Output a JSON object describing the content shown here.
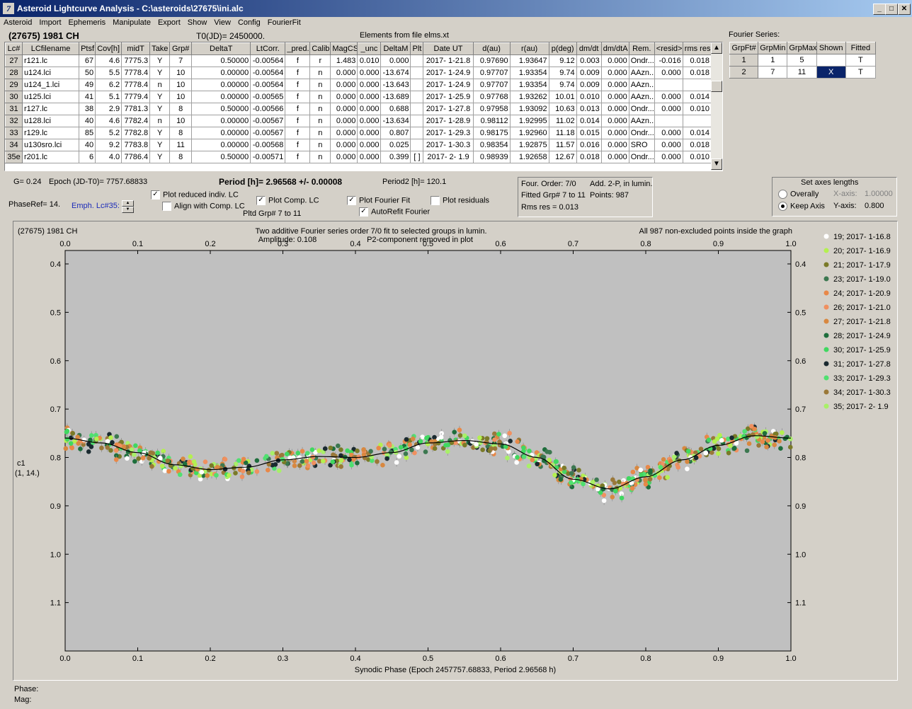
{
  "window": {
    "title": "Asteroid Lightcurve Analysis - C:\\asteroids\\27675\\ini.alc",
    "icon_name": "app-logo-icon"
  },
  "menu": [
    "Asteroid",
    "Import",
    "Ephemeris",
    "Manipulate",
    "Export",
    "Show",
    "View",
    "Config",
    "FourierFit"
  ],
  "header": {
    "asteroid": "(27675) 1981 CH",
    "t0": "T0(JD)= 2450000.",
    "elements": "Elements from file elms.xt"
  },
  "lc_table": {
    "columns": [
      "Lc#",
      "LCfilename",
      "Ptsf",
      "Cov[h]",
      "midT",
      "Take",
      "Grp#",
      "DeltaT",
      "LtCorr.",
      "_pred.",
      "Calib.",
      "MagCS",
      "_unc",
      "DeltaM",
      "Plt",
      "Date UT",
      "d(au)",
      "r(au)",
      "p(deg)",
      "dm/dt",
      "dm/dtA",
      "Rem.",
      "<resid>",
      "rms res"
    ],
    "rows": [
      [
        "27",
        "r121.lc",
        "67",
        "4.6",
        "7775.3",
        "Y",
        "7",
        "0.50000",
        "-0.00564",
        "f",
        "r",
        "1.483",
        "0.010",
        "0.000",
        "",
        "2017- 1-21.8",
        "0.97690",
        "1.93647",
        "9.12",
        "0.003",
        "0.000",
        "Ondr...",
        "-0.016",
        "0.018"
      ],
      [
        "28",
        "u124.lci",
        "50",
        "5.5",
        "7778.4",
        "Y",
        "10",
        "0.00000",
        "-0.00564",
        "f",
        "n",
        "0.000",
        "0.000",
        "-13.674",
        "",
        "2017- 1-24.9",
        "0.97707",
        "1.93354",
        "9.74",
        "0.009",
        "0.000",
        "AAzn...",
        "0.000",
        "0.018"
      ],
      [
        "29",
        "u124_1.lci",
        "49",
        "6.2",
        "7778.4",
        "n",
        "10",
        "0.00000",
        "-0.00564",
        "f",
        "n",
        "0.000",
        "0.000",
        "-13.643",
        "",
        "2017- 1-24.9",
        "0.97707",
        "1.93354",
        "9.74",
        "0.009",
        "0.000",
        "AAzn...",
        "",
        ""
      ],
      [
        "30",
        "u125.lci",
        "41",
        "5.1",
        "7779.4",
        "Y",
        "10",
        "0.00000",
        "-0.00565",
        "f",
        "n",
        "0.000",
        "0.000",
        "-13.689",
        "",
        "2017- 1-25.9",
        "0.97768",
        "1.93262",
        "10.01",
        "0.010",
        "0.000",
        "AAzn...",
        "0.000",
        "0.014"
      ],
      [
        "31",
        "r127.lc",
        "38",
        "2.9",
        "7781.3",
        "Y",
        "8",
        "0.50000",
        "-0.00566",
        "f",
        "n",
        "0.000",
        "0.000",
        "0.688",
        "",
        "2017- 1-27.8",
        "0.97958",
        "1.93092",
        "10.63",
        "0.013",
        "0.000",
        "Ondr...",
        "0.000",
        "0.010"
      ],
      [
        "32",
        "u128.lci",
        "40",
        "4.6",
        "7782.4",
        "n",
        "10",
        "0.00000",
        "-0.00567",
        "f",
        "n",
        "0.000",
        "0.000",
        "-13.634",
        "",
        "2017- 1-28.9",
        "0.98112",
        "1.92995",
        "11.02",
        "0.014",
        "0.000",
        "AAzn...",
        "",
        ""
      ],
      [
        "33",
        "r129.lc",
        "85",
        "5.2",
        "7782.8",
        "Y",
        "8",
        "0.00000",
        "-0.00567",
        "f",
        "n",
        "0.000",
        "0.000",
        "0.807",
        "",
        "2017- 1-29.3",
        "0.98175",
        "1.92960",
        "11.18",
        "0.015",
        "0.000",
        "Ondr...",
        "0.000",
        "0.014"
      ],
      [
        "34",
        "u130sro.lci",
        "40",
        "9.2",
        "7783.8",
        "Y",
        "11",
        "0.00000",
        "-0.00568",
        "f",
        "n",
        "0.000",
        "0.000",
        "0.025",
        "",
        "2017- 1-30.3",
        "0.98354",
        "1.92875",
        "11.57",
        "0.016",
        "0.000",
        "SRO",
        "0.000",
        "0.018"
      ],
      [
        "35e",
        "r201.lc",
        "6",
        "4.0",
        "7786.4",
        "Y",
        "8",
        "0.50000",
        "-0.00571",
        "f",
        "n",
        "0.000",
        "0.000",
        "0.399",
        "[ ]",
        "2017- 2- 1.9",
        "0.98939",
        "1.92658",
        "12.67",
        "0.018",
        "0.000",
        "Ondr...",
        "0.000",
        "0.010"
      ]
    ]
  },
  "fourier_series": {
    "label": "Fourier Series:",
    "columns": [
      "GrpFt#",
      "GrpMin",
      "GrpMax",
      "Shown",
      "Fitted"
    ],
    "rows": [
      [
        "1",
        "1",
        "5",
        "",
        "T"
      ],
      [
        "2",
        "7",
        "11",
        "X",
        "T"
      ]
    ]
  },
  "info": {
    "g": "G= 0.24",
    "epoch": "Epoch (JD-T0)= 7757.68833",
    "period": "Period [h]= 2.96568 +/- 0.00008",
    "period2": "Period2 [h]= 120.1",
    "phase_ref": "PhaseRef= 14.",
    "emph_lc": "Emph. Lc#35:",
    "pltd_grp": "Pltd Grp#  7  to   11"
  },
  "checkboxes": {
    "plot_reduced": {
      "label": "Plot reduced indiv. LC",
      "checked": true
    },
    "align_comp": {
      "label": "Align with Comp. LC",
      "checked": false
    },
    "plot_comp": {
      "label": "Plot Comp. LC",
      "checked": true
    },
    "plot_fourier": {
      "label": "Plot Fourier Fit",
      "checked": true
    },
    "autorefit": {
      "label": "AutoRefit Fourier",
      "checked": true
    },
    "plot_resid": {
      "label": "Plot residuals",
      "checked": false
    }
  },
  "fit_info": {
    "four_order": "Four. Order:  7/0",
    "add": "Add. 2-P, in lumin.",
    "fitted": "Fitted Grp# 7 to 11",
    "points": "Points: 987",
    "rms": "Rms res      = 0.013"
  },
  "axes_box": {
    "title": "Set axes lengths",
    "overall": "Overally",
    "keep": "Keep Axis",
    "selected": "keep",
    "x_label": "X-axis:",
    "x_value": "1.00000",
    "y_label": "Y-axis:",
    "y_value": "0.800"
  },
  "chart_data": {
    "type": "scatter",
    "title": "(27675) 1981 CH",
    "subtitle_line1": "Two additive Fourier series order 7/0 fit to selected groups in lumin.",
    "subtitle_line2": "Amplitude: 0.108",
    "subtitle_line3": "P2-component removed in plot",
    "note": "All 987 non-excluded points inside the graph",
    "xlabel": "Synodic Phase (Epoch 2457757.68833, Period 2.96568 h)",
    "ylabel": "c1",
    "ylabel2": "(1, 14.)",
    "xlim": [
      0,
      1
    ],
    "ylim": [
      0.4,
      1.2
    ],
    "y_inverted": true,
    "xticks": [
      0.0,
      0.1,
      0.2,
      0.3,
      0.4,
      0.5,
      0.6,
      0.7,
      0.8,
      0.9,
      1.0
    ],
    "yticks": [
      0.4,
      0.5,
      0.6,
      0.7,
      0.8,
      0.9,
      1.0,
      1.1
    ],
    "fit_curve": {
      "x": [
        0.0,
        0.05,
        0.1,
        0.15,
        0.2,
        0.25,
        0.3,
        0.35,
        0.4,
        0.45,
        0.5,
        0.55,
        0.6,
        0.65,
        0.7,
        0.75,
        0.8,
        0.85,
        0.9,
        0.95,
        1.0
      ],
      "y": [
        0.76,
        0.77,
        0.79,
        0.815,
        0.825,
        0.82,
        0.805,
        0.798,
        0.8,
        0.79,
        0.77,
        0.765,
        0.772,
        0.8,
        0.845,
        0.865,
        0.84,
        0.805,
        0.775,
        0.755,
        0.76
      ]
    },
    "series": [
      {
        "name": "19; 2017- 1-16.8",
        "color": "#ffffff"
      },
      {
        "name": "20; 2017- 1-16.9",
        "color": "#b4f050"
      },
      {
        "name": "21; 2017- 1-17.9",
        "color": "#7a7a28"
      },
      {
        "name": "23; 2017- 1-19.0",
        "color": "#3c7850"
      },
      {
        "name": "24; 2017- 1-20.9",
        "color": "#e88848"
      },
      {
        "name": "26; 2017- 1-21.0",
        "color": "#f09060"
      },
      {
        "name": "27; 2017- 1-21.8",
        "color": "#d88840"
      },
      {
        "name": "28; 2017- 1-24.9",
        "color": "#1e6e3c"
      },
      {
        "name": "30; 2017- 1-25.9",
        "color": "#40d860"
      },
      {
        "name": "31; 2017- 1-27.8",
        "color": "#1a2a30"
      },
      {
        "name": "33; 2017- 1-29.3",
        "color": "#50e070"
      },
      {
        "name": "34; 2017- 1-30.3",
        "color": "#9a7838"
      },
      {
        "name": "35; 2017- 2- 1.9",
        "color": "#a8f068"
      }
    ]
  },
  "status": {
    "phase": "Phase:",
    "mag": "Mag:"
  }
}
